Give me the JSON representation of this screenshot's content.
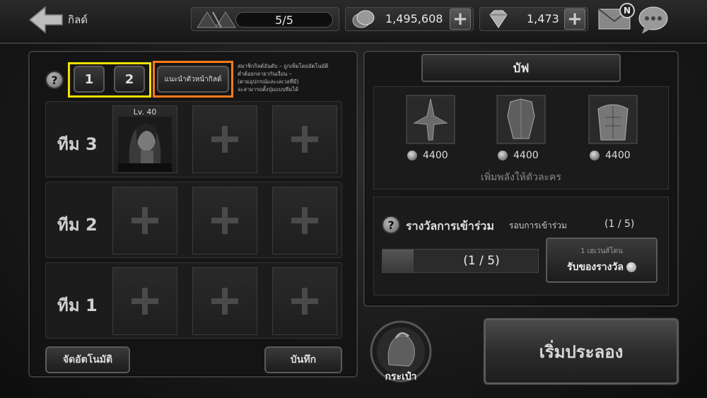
{
  "header": {
    "back_label": "กิลด์",
    "stamina_value": "5/5",
    "coins_value": "1,495,608",
    "gems_value": "1,473",
    "mail_badge": "N"
  },
  "left_panel": {
    "help_label": "?",
    "page_tabs": [
      "1",
      "2"
    ],
    "recommend_button": "แนะนำตัวหน้ากิลด์",
    "info_text": [
      "สมาชิกกิลด์อันดับ – ถูกเพิ่มโดยอัตโนมัติ",
      "ต่ำต้อยกลายากันเงื่อน –",
      "(ตามอุปกรณ์และเลเวลที่มี)",
      "จะสามารถตั้งปุ่มแบบทีมได้"
    ],
    "teams": [
      {
        "label": "ทีม 3",
        "hero_level": "Lv. 40"
      },
      {
        "label": "ทีม 2"
      },
      {
        "label": "ทีม 1"
      }
    ],
    "auto_button": "จัดอัตโนมัติ",
    "save_button": "บันทึก"
  },
  "right_panel": {
    "buff_title": "บัฟ",
    "buffs": [
      {
        "icon": "weapon-icon",
        "cost": "4400"
      },
      {
        "icon": "armor-icon",
        "cost": "4400"
      },
      {
        "icon": "body-icon",
        "cost": "4400"
      }
    ],
    "buff_desc": "เพิ่มพลังให้ตัวละคร",
    "reward_title": "รางวัลการเข้าร่วม",
    "round_label": "รอบการเข้าร่วม",
    "round_count": "(1 / 5)",
    "progress_text": "(1 / 5)",
    "progress_fraction": 0.2,
    "claim_sub": "1 เฮเว่นส์โตน",
    "claim_label": "รับของรางวัล"
  },
  "footer": {
    "bag_label": "กระเป๋า",
    "start_button": "เริ่มประลอง"
  },
  "colors": {
    "highlight_yellow": "#f2e200",
    "highlight_orange": "#ff7a1a"
  }
}
